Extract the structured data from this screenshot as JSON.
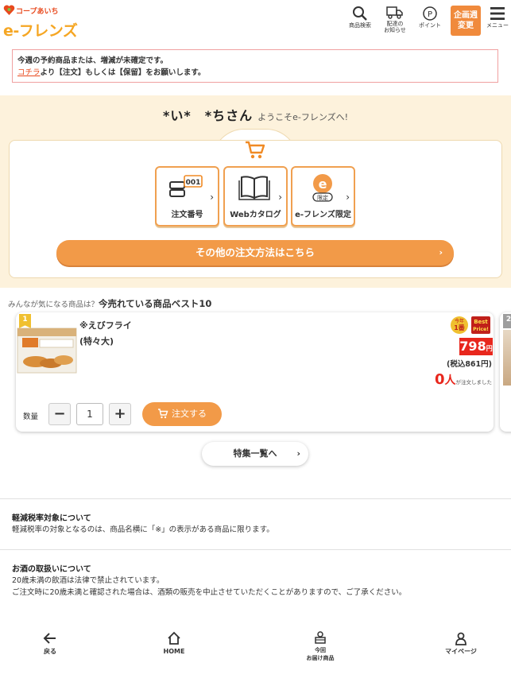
{
  "header": {
    "coop_label": "コープあいち",
    "brand_label": "e-フレンズ",
    "icons": [
      {
        "icon": "search-icon",
        "label": "商品検索"
      },
      {
        "icon": "truck-icon",
        "label": "配達の\nお知らせ"
      },
      {
        "icon": "point-icon",
        "label": "ポイント"
      }
    ],
    "kikaku_label": "企画週\n変更",
    "menu_label": "メニュー"
  },
  "notice": {
    "line1": "今週の予約商品または、増減が未確定です。",
    "link": "コチラ",
    "line2_rest": "より【注文】もしくは【保留】をお願いします。"
  },
  "welcome": {
    "name": "*い*　*ちさん",
    "message": "ようこそe-フレンズへ!"
  },
  "order_methods": [
    {
      "icon": "order-number-icon",
      "label": "注文番号",
      "badge": "001"
    },
    {
      "icon": "web-catalog-icon",
      "label": "Webカタログ"
    },
    {
      "icon": "e-friends-limited-icon",
      "label": "e-フレンズ限定",
      "badge": "限定"
    }
  ],
  "other_methods_label": "その他の注文方法はこちら",
  "best": {
    "prefix": "みんなが気になる商品は？",
    "title": "今売れている商品ベスト10",
    "products": [
      {
        "rank": "1",
        "name_line1": "※えびフライ",
        "name_line2": "(特々大)",
        "badge1_top": "今年",
        "badge1_main": "1番",
        "badge2_top": "Best",
        "badge2_main": "Price!",
        "price": "798",
        "yen": "円",
        "tax_in": "(税込861円)",
        "ordered_count": "0",
        "ordered_unit": "人",
        "ordered_suffix": "が注文しました",
        "qty_label": "数量",
        "qty_value": "1",
        "minus": "−",
        "plus": "+",
        "order_label": "注文する"
      }
    ],
    "next_rank": "2"
  },
  "feature_list_label": "特集一覧へ",
  "info": {
    "tax_heading": "軽減税率対象について",
    "tax_text": "軽減税率の対象となるのは、商品名横に「※」の表示がある商品に限ります。",
    "alcohol_heading": "お酒の取扱いについて",
    "alcohol_text1": "20歳未満の飲酒は法律で禁止されています。",
    "alcohol_text2": "ご注文時に20歳未満と確認された場合は、酒類の販売を中止させていただくことがありますので、ご了承ください。"
  },
  "bottom_nav": [
    {
      "icon": "back-arrow-icon",
      "label": "戻る"
    },
    {
      "icon": "home-icon",
      "label": "HOME"
    },
    {
      "icon": "delivery-box-icon",
      "label": "今回\nお届け商品"
    },
    {
      "icon": "user-icon",
      "label": "マイページ"
    }
  ],
  "colors": {
    "accent_orange": "#f29a48",
    "price_red": "#e8271d",
    "welcome_bg": "#fdf2dc"
  }
}
